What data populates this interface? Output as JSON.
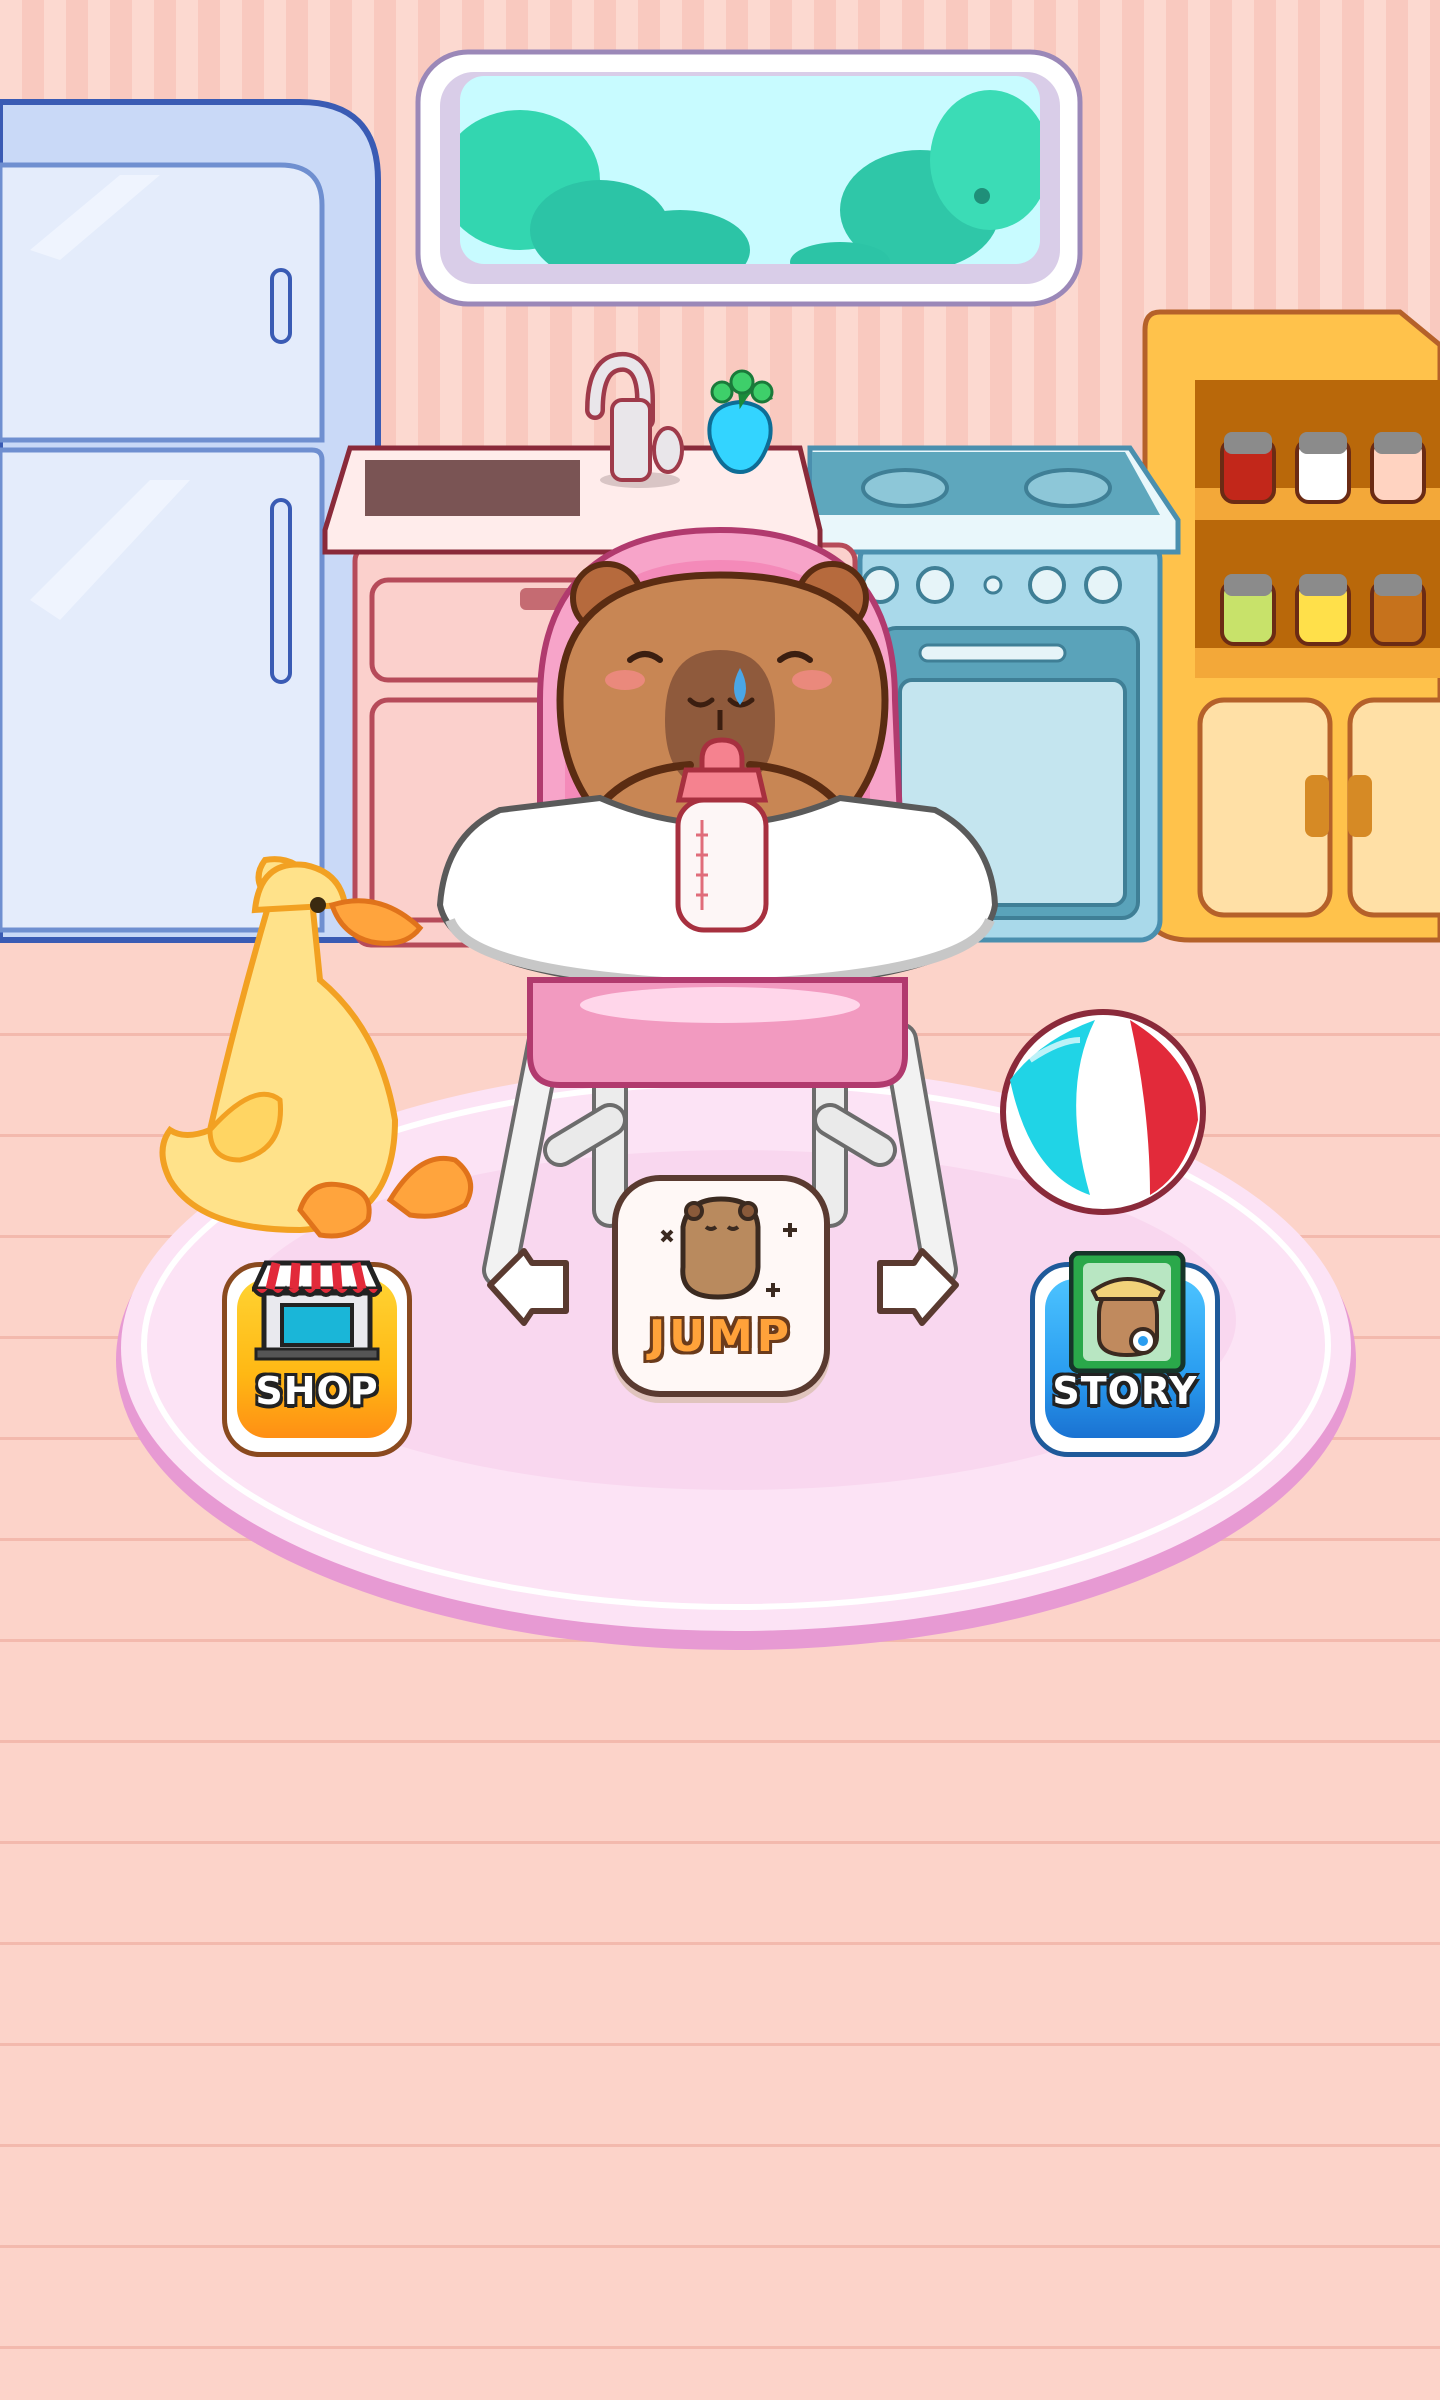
{
  "buttons": {
    "shop_label": "SHOP",
    "story_label": "STORY",
    "jump_label": "JUMP"
  },
  "icons": {
    "shop": "storefront-icon",
    "story": "storybook-icon",
    "jump": "capybara-jump-icon",
    "prev": "left-arrow-icon",
    "next": "right-arrow-icon"
  },
  "colors": {
    "wall": "#fcd9d0",
    "floor": "#fcd3c9",
    "rug": "#f8c8ef",
    "chair": "#f29ac0",
    "shop": "#ffb814",
    "story": "#2a9df0"
  }
}
